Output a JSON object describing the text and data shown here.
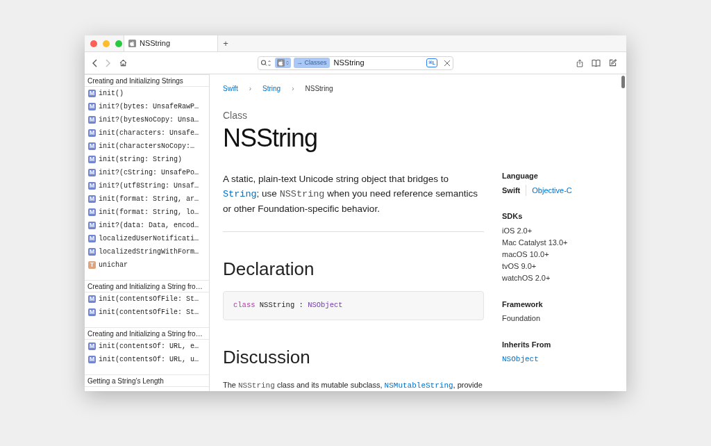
{
  "tab": {
    "title": "NSString",
    "new_tab": "+"
  },
  "search": {
    "token": "→ Classes",
    "value": "NSString",
    "shortcut": "⌘L"
  },
  "sidebar": {
    "sections": [
      {
        "title": "Creating and Initializing Strings",
        "items": [
          {
            "kind": "method",
            "badge": "M",
            "label": "init()"
          },
          {
            "kind": "method",
            "badge": "M",
            "label": "init?(bytes: UnsafeRawP…"
          },
          {
            "kind": "method",
            "badge": "M",
            "label": "init?(bytesNoCopy: Unsa…"
          },
          {
            "kind": "method",
            "badge": "M",
            "label": "init(characters: Unsafe…"
          },
          {
            "kind": "method",
            "badge": "M",
            "label": "init(charactersNoCopy:…"
          },
          {
            "kind": "method",
            "badge": "M",
            "label": "init(string: String)"
          },
          {
            "kind": "method",
            "badge": "M",
            "label": "init?(cString: UnsafePo…"
          },
          {
            "kind": "method",
            "badge": "M",
            "label": "init?(utf8String: Unsaf…"
          },
          {
            "kind": "method",
            "badge": "M",
            "label": "init(format: String, ar…"
          },
          {
            "kind": "method",
            "badge": "M",
            "label": "init(format: String, lo…"
          },
          {
            "kind": "method",
            "badge": "M",
            "label": "init?(data: Data, encod…"
          },
          {
            "kind": "method",
            "badge": "M",
            "label": "localizedUserNotificati…"
          },
          {
            "kind": "method",
            "badge": "M",
            "label": "localizedStringWithForm…"
          },
          {
            "kind": "type",
            "badge": "T",
            "label": "unichar"
          }
        ]
      },
      {
        "title": "Creating and Initializing a String fro…",
        "items": [
          {
            "kind": "method",
            "badge": "M",
            "label": "init(contentsOfFile: St…"
          },
          {
            "kind": "method",
            "badge": "M",
            "label": "init(contentsOfFile: St…"
          }
        ]
      },
      {
        "title": "Creating and Initializing a String fro…",
        "items": [
          {
            "kind": "method",
            "badge": "M",
            "label": "init(contentsOf: URL, e…"
          },
          {
            "kind": "method",
            "badge": "M",
            "label": "init(contentsOf: URL, u…"
          }
        ]
      },
      {
        "title": "Getting a String’s Length"
      }
    ]
  },
  "breadcrumbs": [
    {
      "label": "Swift",
      "kind": "link"
    },
    {
      "label": "›",
      "kind": "separator"
    },
    {
      "label": "String",
      "kind": "link"
    },
    {
      "label": "›",
      "kind": "separator"
    },
    {
      "label": "NSString",
      "kind": "current"
    }
  ],
  "eyebrow": "Class",
  "title": "NSString",
  "abstract": [
    {
      "kind": "text",
      "text": "A static, plain-text Unicode string object that bridges to "
    },
    {
      "kind": "codelink",
      "text": "String"
    },
    {
      "kind": "text",
      "text": "; use "
    },
    {
      "kind": "code",
      "text": "NSString"
    },
    {
      "kind": "text",
      "text": " when you need reference semantics or other Foundation-specific behavior."
    }
  ],
  "declaration": {
    "heading": "Declaration",
    "tokens": [
      {
        "kind": "keyword",
        "text": "class"
      },
      {
        "kind": "plain",
        "text": " NSString : "
      },
      {
        "kind": "type",
        "text": "NSObject"
      }
    ]
  },
  "discussion": {
    "heading": "Discussion",
    "text": [
      {
        "kind": "text",
        "text": "The "
      },
      {
        "kind": "code",
        "text": "NSString"
      },
      {
        "kind": "text",
        "text": " class and its mutable subclass, "
      },
      {
        "kind": "codelink",
        "text": "NSMutableString"
      },
      {
        "kind": "text",
        "text": ", provide"
      }
    ]
  },
  "aside": [
    {
      "heading": "Language",
      "kind": "languages",
      "items": [
        {
          "label": "Swift",
          "selected": true
        },
        {
          "label": "Objective-C",
          "selected": false
        }
      ]
    },
    {
      "heading": "SDKs",
      "kind": "list",
      "items": [
        {
          "label": "iOS 2.0+"
        },
        {
          "label": "Mac Catalyst 13.0+"
        },
        {
          "label": "macOS 10.0+"
        },
        {
          "label": "tvOS 9.0+"
        },
        {
          "label": "watchOS 2.0+"
        }
      ]
    },
    {
      "heading": "Framework",
      "kind": "list",
      "items": [
        {
          "label": "Foundation"
        }
      ]
    },
    {
      "heading": "Inherits From",
      "kind": "codelinks",
      "items": [
        {
          "label": "NSObject"
        }
      ]
    }
  ]
}
